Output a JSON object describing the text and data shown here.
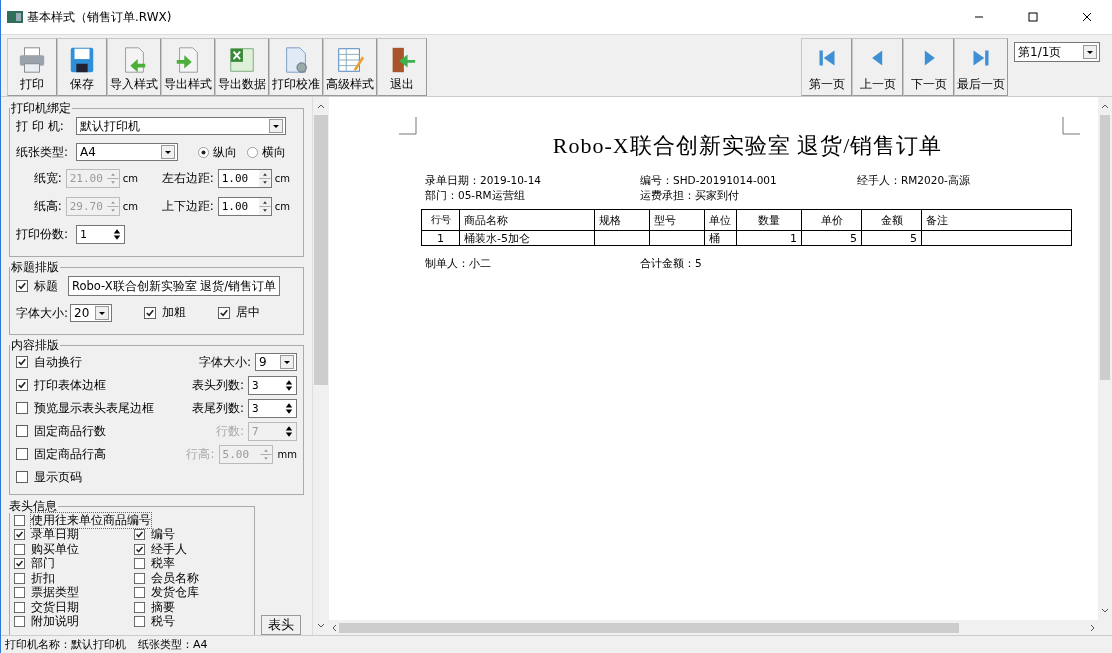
{
  "window": {
    "title": "基本样式（销售订单.RWX)"
  },
  "toolbar": {
    "buttons": [
      {
        "label": "打印",
        "kind": "print"
      },
      {
        "label": "保存",
        "kind": "save"
      },
      {
        "label": "导入样式",
        "kind": "import"
      },
      {
        "label": "导出样式",
        "kind": "export"
      },
      {
        "label": "导出数据",
        "kind": "excel"
      },
      {
        "label": "打印校准",
        "kind": "calibrate"
      },
      {
        "label": "高级样式",
        "kind": "advanced"
      },
      {
        "label": "退出",
        "kind": "exit"
      }
    ],
    "nav": [
      {
        "label": "第一页",
        "kind": "first"
      },
      {
        "label": "上一页",
        "kind": "prev"
      },
      {
        "label": "下一页",
        "kind": "next"
      },
      {
        "label": "最后一页",
        "kind": "last"
      }
    ],
    "page_select": "第1/1页"
  },
  "printer_binding": {
    "legend": "打印机绑定",
    "printer": {
      "label": "打 印 机:",
      "value": "默认打印机"
    },
    "paper": {
      "label": "纸张类型:",
      "value": "A4"
    },
    "orientation": [
      {
        "label": "纵向",
        "selected": true
      },
      {
        "label": "横向",
        "selected": false
      }
    ],
    "spinners": [
      {
        "label": "纸宽:",
        "value": "21.00",
        "unit": "cm",
        "disabled": true
      },
      {
        "label": "左右边距:",
        "value": "1.00",
        "unit": "cm",
        "disabled": false
      },
      {
        "label": "纸高:",
        "value": "29.70",
        "unit": "cm",
        "disabled": true
      },
      {
        "label": "上下边距:",
        "value": "1.00",
        "unit": "cm",
        "disabled": false
      }
    ],
    "copies": {
      "label": "打印份数:",
      "value": "1"
    }
  },
  "title_layout": {
    "legend": "标题排版",
    "title": {
      "label": "标题",
      "checked": true,
      "value": "Robo-X联合创新实验室 退货/销售订单"
    },
    "font_size": {
      "label": "字体大小:",
      "value": "20"
    },
    "options": [
      {
        "label": "加粗",
        "checked": true
      },
      {
        "label": "居中",
        "checked": true
      }
    ]
  },
  "content_layout": {
    "legend": "内容排版",
    "rows": [
      {
        "label": "自动换行",
        "checked": true,
        "field": {
          "kind": "select",
          "label": "字体大小:",
          "value": "9",
          "disabled": false
        }
      },
      {
        "label": "打印表体边框",
        "checked": true,
        "field": {
          "kind": "updown",
          "label": "表头列数:",
          "value": "3",
          "disabled": false
        }
      },
      {
        "label": "预览显示表头表尾边框",
        "checked": false,
        "field": {
          "kind": "updown",
          "label": "表尾列数:",
          "value": "3",
          "disabled": false
        }
      },
      {
        "label": "固定商品行数",
        "checked": false,
        "field": {
          "kind": "updown",
          "label": "行数:",
          "value": "7",
          "disabled": true
        }
      },
      {
        "label": "固定商品行高",
        "checked": false,
        "field": {
          "kind": "spin",
          "label": "行高:",
          "value": "5.00",
          "unit": "mm",
          "disabled": true
        }
      },
      {
        "label": "显示页码",
        "checked": false
      }
    ]
  },
  "header_info": {
    "legend": "表头信息",
    "top": {
      "label": "使用往来单位商品编号",
      "checked": false
    },
    "items": [
      {
        "label": "录单日期",
        "checked": true
      },
      {
        "label": "编号",
        "checked": true
      },
      {
        "label": "购买单位",
        "checked": false
      },
      {
        "label": "经手人",
        "checked": true
      },
      {
        "label": "部门",
        "checked": true
      },
      {
        "label": "税率",
        "checked": false
      },
      {
        "label": "折扣",
        "checked": false
      },
      {
        "label": "会员名称",
        "checked": false
      },
      {
        "label": "票据类型",
        "checked": false
      },
      {
        "label": "发货仓库",
        "checked": false
      },
      {
        "label": "交货日期",
        "checked": false
      },
      {
        "label": "摘要",
        "checked": false
      },
      {
        "label": "附加说明",
        "checked": false
      },
      {
        "label": "税号",
        "checked": false
      }
    ],
    "tab": "表头"
  },
  "preview": {
    "title": "Robo-X联合创新实验室 退货/销售订单",
    "info": [
      [
        "录单日期：2019-10-14",
        "编号：SHD-20191014-001",
        "经手人：RM2020-高源"
      ],
      [
        "部门：05-RM运营组",
        "运费承担：买家到付"
      ]
    ],
    "table": {
      "columns": [
        "行号",
        "商品名称",
        "规格",
        "型号",
        "单位",
        "数量",
        "单价",
        "金额",
        "备注"
      ],
      "rows": [
        [
          "1",
          "桶装水-5加仑",
          null,
          null,
          "桶",
          "1",
          "5",
          "5",
          null
        ]
      ]
    },
    "footer": [
      "制单人：小二",
      "合计金额：5"
    ]
  },
  "status_bar": [
    "打印机名称：默认打印机",
    "纸张类型：A4"
  ]
}
